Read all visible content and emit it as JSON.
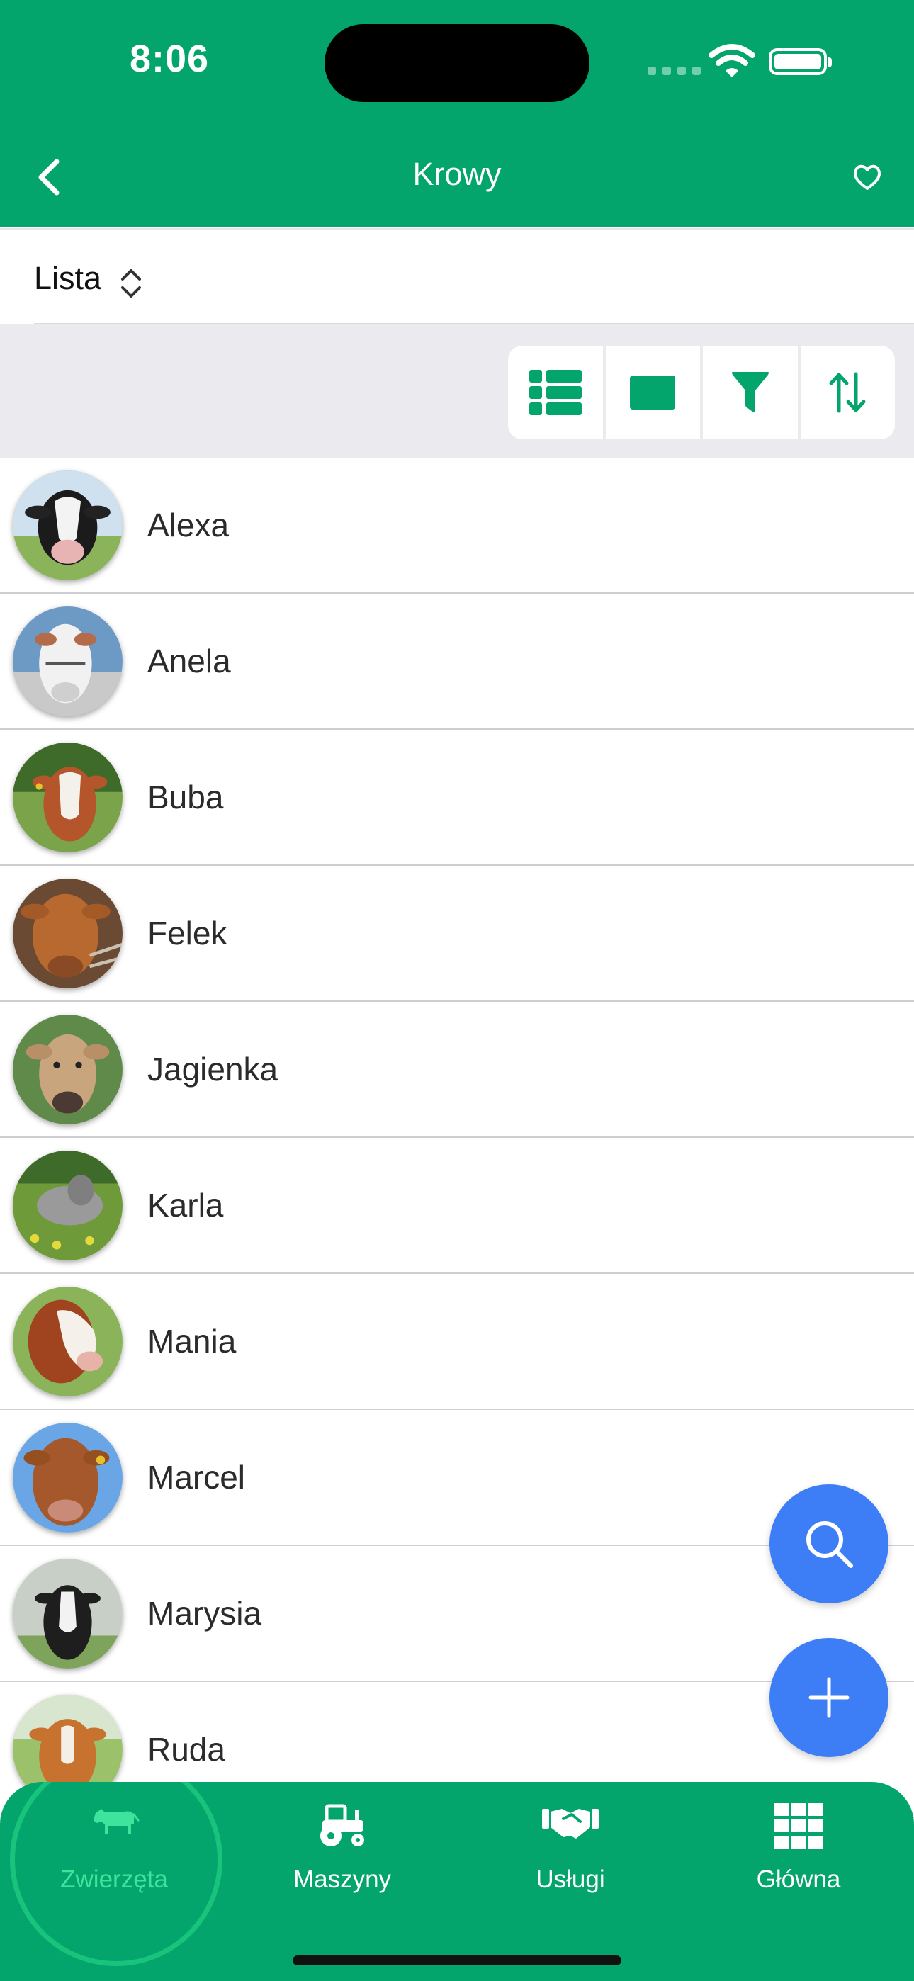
{
  "status_bar": {
    "time": "8:06"
  },
  "nav": {
    "title": "Krowy"
  },
  "mode": {
    "label": "Lista"
  },
  "animals": [
    {
      "name": "Alexa"
    },
    {
      "name": "Anela"
    },
    {
      "name": "Buba"
    },
    {
      "name": "Felek"
    },
    {
      "name": "Jagienka"
    },
    {
      "name": "Karla"
    },
    {
      "name": "Mania"
    },
    {
      "name": "Marcel"
    },
    {
      "name": "Marysia"
    },
    {
      "name": "Ruda"
    }
  ],
  "tabs": [
    {
      "label": "Zwierzęta",
      "icon": "cow-icon",
      "active": true
    },
    {
      "label": "Maszyny",
      "icon": "tractor-icon"
    },
    {
      "label": "Usługi",
      "icon": "handshake-icon"
    },
    {
      "label": "Główna",
      "icon": "grid-icon"
    }
  ],
  "colors": {
    "primary": "#03a56c",
    "fab": "#3d7df5",
    "active_tab": "#3ee39c"
  }
}
